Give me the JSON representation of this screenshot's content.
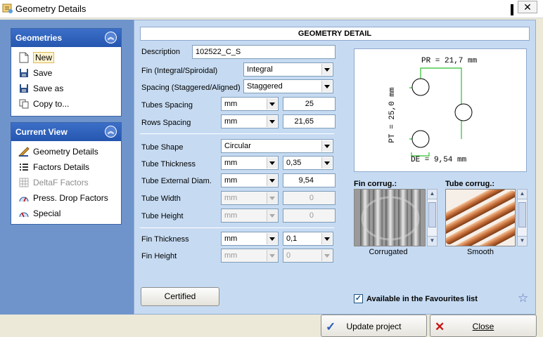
{
  "window": {
    "title": "Geometry Details"
  },
  "sidebar": {
    "geometries": {
      "title": "Geometries",
      "items": [
        {
          "label": "New",
          "icon": "new-document-icon"
        },
        {
          "label": "Save",
          "icon": "floppy-disk-icon"
        },
        {
          "label": "Save as",
          "icon": "floppy-disk-icon"
        },
        {
          "label": "Copy to...",
          "icon": "copy-icon"
        }
      ]
    },
    "current_view": {
      "title": "Current View",
      "items": [
        {
          "label": "Geometry Details",
          "icon": "ruler-icon",
          "disabled": false
        },
        {
          "label": "Factors Details",
          "icon": "list-icon",
          "disabled": false
        },
        {
          "label": "DeltaF Factors",
          "icon": "table-icon",
          "disabled": true
        },
        {
          "label": "Press. Drop Factors",
          "icon": "gauge-icon",
          "disabled": false
        },
        {
          "label": "Special",
          "icon": "gauge-icon",
          "disabled": false
        }
      ]
    }
  },
  "main": {
    "header": "GEOMETRY DETAIL",
    "description": {
      "label": "Description",
      "value": "102522_C_S"
    },
    "fin_type": {
      "label": "Fin (Integral/Spiroidal)",
      "value": "Integral"
    },
    "spacing_type": {
      "label": "Spacing (Staggered/Aligned)",
      "value": "Staggered"
    },
    "tubes_spacing": {
      "label": "Tubes Spacing",
      "unit": "mm",
      "value": "25"
    },
    "rows_spacing": {
      "label": "Rows Spacing",
      "unit": "mm",
      "value": "21,65"
    },
    "tube_shape": {
      "label": "Tube Shape",
      "value": "Circular"
    },
    "tube_thickness": {
      "label": "Tube Thickness",
      "unit": "mm",
      "value": "0,35"
    },
    "tube_ext_diam": {
      "label": "Tube External Diam.",
      "unit": "mm",
      "value": "9,54"
    },
    "tube_width": {
      "label": "Tube Width",
      "unit": "mm",
      "value": "0"
    },
    "tube_height": {
      "label": "Tube Height",
      "unit": "mm",
      "value": "0"
    },
    "fin_thickness": {
      "label": "Fin Thickness",
      "unit": "mm",
      "value": "0,1"
    },
    "fin_height": {
      "label": "Fin Height",
      "unit": "mm",
      "value": "0"
    },
    "diagram": {
      "pr_label": "PR = 21,7 mm",
      "pt_label": "PT = 25,0 mm",
      "de_label": "DE = 9,54 mm"
    },
    "fin_corrug": {
      "label": "Fin corrug.:",
      "caption": "Corrugated"
    },
    "tube_corrug": {
      "label": "Tube corrug.:",
      "caption": "Smooth"
    },
    "certified_button": "Certified",
    "favourites": {
      "label": "Available in the Favourites list",
      "checked": true
    }
  },
  "footer": {
    "update_button": "Update project",
    "close_button": "Close"
  }
}
